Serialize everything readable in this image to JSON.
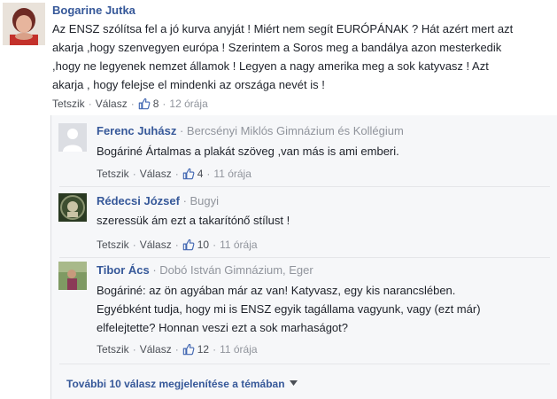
{
  "main_comment": {
    "author": "Bogarine Jutka",
    "lines": [
      "Az ENSZ szólítsa fel a jó kurva anyját ! Miért nem segít EURÓPÁNAK ? Hát azért mert azt",
      "akarja ,hogy szenvegyen európa ! Szerintem a Soros meg a bandálya azon mesterkedik",
      ",hogy ne legyenek nemzet államok ! Legyen a nagy amerika meg a sok katyvasz ! Azt",
      "akarja , hogy felejse el mindenki az országa nevét is !"
    ],
    "like_label": "Tetszik",
    "reply_label": "Válasz",
    "likes": "8",
    "time": "12 órája"
  },
  "replies": [
    {
      "author": "Ferenc Juhász",
      "affiliation": "Bercsényi Miklós Gimnázium és Kollégium",
      "lines": [
        "Bogáriné Ártalmas a plakát szöveg ,van más is ami emberi."
      ],
      "like_label": "Tetszik",
      "reply_label": "Válasz",
      "likes": "4",
      "time": "11 órája"
    },
    {
      "author": "Rédecsi József",
      "affiliation": "Bugyi",
      "lines": [
        "szeressük ám ezt a takarítónő stílust !"
      ],
      "like_label": "Tetszik",
      "reply_label": "Válasz",
      "likes": "10",
      "time": "11 órája"
    },
    {
      "author": "Tibor Ács",
      "affiliation": "Dobó István Gimnázium, Eger",
      "lines": [
        "Bogáriné: az ön agyában már az van! Katyvasz, egy kis narancslében.",
        "Egyébként tudja, hogy mi is ENSZ egyik tagállama vagyunk, vagy (ezt már)",
        "elfelejtette? Honnan veszi ezt a sok marhaságot?"
      ],
      "like_label": "Tetszik",
      "reply_label": "Válasz",
      "likes": "12",
      "time": "11 órája"
    }
  ],
  "more_replies_label": "További 10 válasz megjelenítése a témában",
  "colors": {
    "link": "#365899",
    "meta": "#90949c",
    "reply_bg": "#f6f7f9"
  },
  "icons": [
    "like-thumb-icon",
    "caret-down-icon"
  ]
}
